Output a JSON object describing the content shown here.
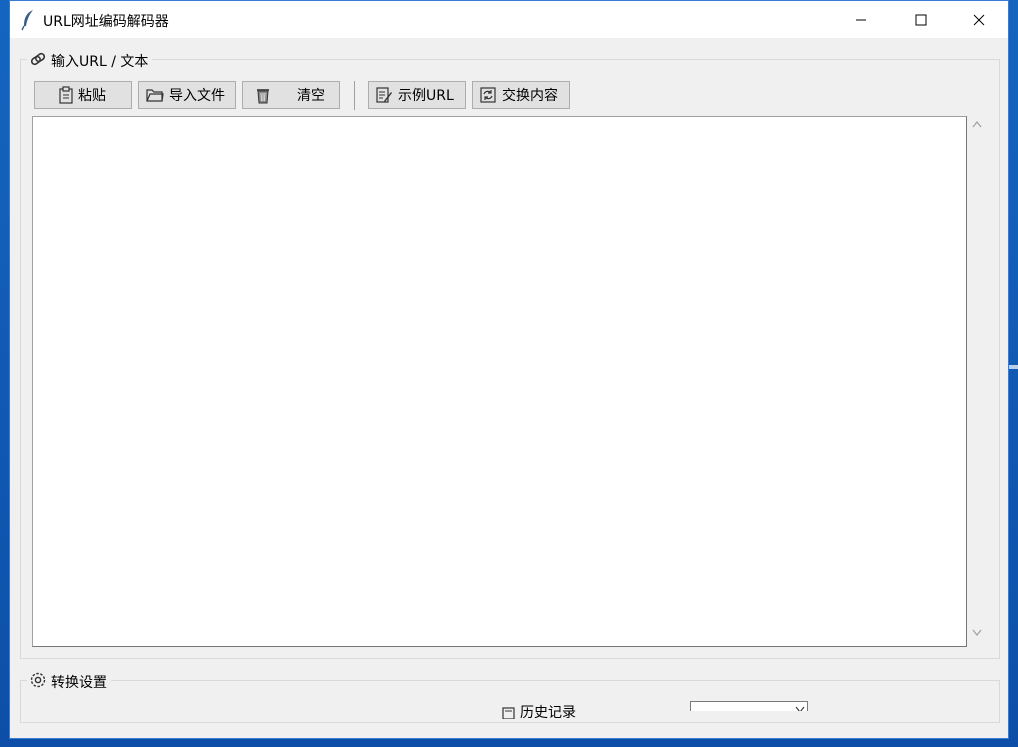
{
  "window": {
    "title": "URL网址编码解码器",
    "controls": {
      "minimize": "minimize",
      "maximize": "maximize",
      "close": "close"
    }
  },
  "input_group": {
    "legend_icon": "link-icon",
    "legend": "输入URL / 文本",
    "toolbar": {
      "paste": {
        "label": "粘贴",
        "icon": "clipboard-icon"
      },
      "import": {
        "label": "导入文件",
        "icon": "folder-icon"
      },
      "clear": {
        "label": "清空",
        "icon": "trash-icon"
      },
      "sample": {
        "label": "示例URL",
        "icon": "memo-icon"
      },
      "swap": {
        "label": "交换内容",
        "icon": "swap-icon"
      }
    },
    "text_value": ""
  },
  "settings_group": {
    "legend_icon": "gear-icon",
    "legend": "转换设置",
    "history_label": "历史记录"
  }
}
